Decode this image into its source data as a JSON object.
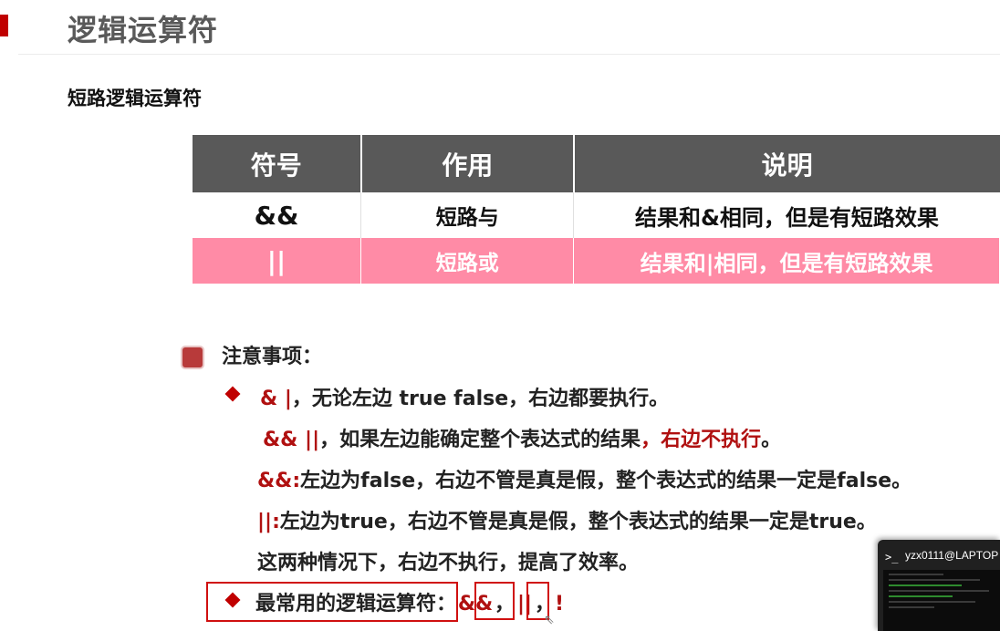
{
  "slide": {
    "title": "逻辑运算符",
    "subtitle": "短路逻辑运算符"
  },
  "table": {
    "headers": [
      "符号",
      "作用",
      "说明"
    ],
    "rows": [
      {
        "symbol": "&&",
        "function": "短路与",
        "description": "结果和&相同，但是有短路效果"
      },
      {
        "symbol": "||",
        "function": "短路或",
        "description": "结果和|相同，但是有短路效果"
      }
    ],
    "highlight_color": "#ff8ba6",
    "header_color": "#595959"
  },
  "notes": {
    "heading": "注意事项：",
    "line1_ops": "& |",
    "line1_text": "，无论左边 true false，右边都要执行。",
    "line2_ops": "&& ||",
    "line2_text": "，如果左边能确定整个表达式的结果",
    "line2_emph": "，右边不执行",
    "line2_end": "。",
    "line3_op": "&&:",
    "line3_text": "左边为false，右边不管是真是假，整个表达式的结果一定是false。",
    "line4_op": "||:",
    "line4_text": "左边为true，右边不管是真是假，整个表达式的结果一定是true。",
    "line5_text": "这两种情况下，右边不执行，提高了效率。",
    "common_label": "最常用的逻辑运算符：",
    "common_op1": "&&",
    "common_sep1": "，",
    "common_op2": "||",
    "common_sep2": "，",
    "common_op3": "!"
  },
  "terminal": {
    "title": "yzx0111@LAPTOP",
    "icon": "terminal-icon"
  },
  "colors": {
    "accent": "#c00000",
    "emphasis": "#b01010"
  }
}
